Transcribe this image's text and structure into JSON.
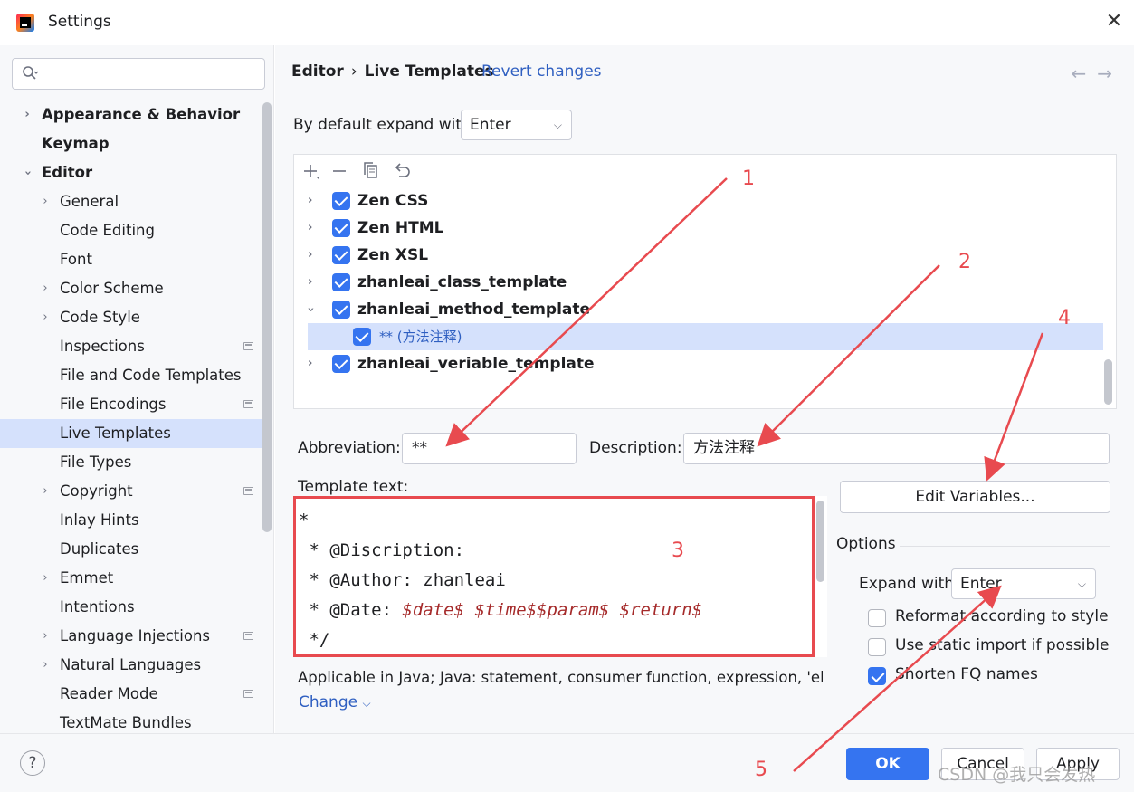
{
  "window": {
    "title": "Settings",
    "close_glyph": "✕"
  },
  "sidebar": {
    "search_placeholder": "",
    "items": [
      {
        "label": "Appearance & Behavior"
      },
      {
        "label": "Keymap"
      },
      {
        "label": "Editor"
      },
      {
        "label": "General"
      },
      {
        "label": "Code Editing"
      },
      {
        "label": "Font"
      },
      {
        "label": "Color Scheme"
      },
      {
        "label": "Code Style"
      },
      {
        "label": "Inspections"
      },
      {
        "label": "File and Code Templates"
      },
      {
        "label": "File Encodings"
      },
      {
        "label": "Live Templates"
      },
      {
        "label": "File Types"
      },
      {
        "label": "Copyright"
      },
      {
        "label": "Inlay Hints"
      },
      {
        "label": "Duplicates"
      },
      {
        "label": "Emmet"
      },
      {
        "label": "Intentions"
      },
      {
        "label": "Language Injections"
      },
      {
        "label": "Natural Languages"
      },
      {
        "label": "Reader Mode"
      },
      {
        "label": "TextMate Bundles"
      }
    ]
  },
  "header": {
    "crumb1": "Editor",
    "sep": "›",
    "crumb2": "Live Templates",
    "revert": "Revert changes",
    "back": "←",
    "forward": "→"
  },
  "expand": {
    "label": "By default expand with",
    "value": "Enter"
  },
  "templates": {
    "groups": [
      {
        "name": "Zen CSS"
      },
      {
        "name": "Zen HTML"
      },
      {
        "name": "Zen XSL"
      },
      {
        "name": "zhanleai_class_template"
      },
      {
        "name": "zhanleai_method_template"
      },
      {
        "name": "** (方法注释)"
      },
      {
        "name": "zhanleai_veriable_template"
      }
    ]
  },
  "form": {
    "abbrev_label": "Abbreviation:",
    "abbrev_value": "**",
    "desc_label": "Description:",
    "desc_value": "方法注释",
    "template_text_label": "Template text:",
    "code_lines": [
      {
        "plain": "*",
        "vars": ""
      },
      {
        "plain": " * @Discription:",
        "vars": ""
      },
      {
        "plain": " * @Author: zhanleai",
        "vars": ""
      },
      {
        "plain": " * @Date: ",
        "vars": "$date$ $time$$param$ $return$"
      },
      {
        "plain": " */",
        "vars": ""
      }
    ],
    "applicable": "Applicable in Java; Java: statement, consumer function, expression, 'else' p...",
    "change": "Change"
  },
  "options": {
    "edit_variables": "Edit Variables...",
    "title": "Options",
    "expand_label": "Expand with",
    "expand_value": "Enter",
    "reformat": "Reformat according to style",
    "static_import": "Use static import if possible",
    "shorten": "Shorten FQ names"
  },
  "footer": {
    "help": "?",
    "ok": "OK",
    "cancel": "Cancel",
    "apply": "Apply",
    "watermark": "CSDN @我只会发热"
  },
  "annotations": [
    "1",
    "2",
    "3",
    "4",
    "5"
  ],
  "colors": {
    "accent": "#3574f0",
    "annotation": "#e84a4f",
    "selection": "#d5e1fc"
  }
}
